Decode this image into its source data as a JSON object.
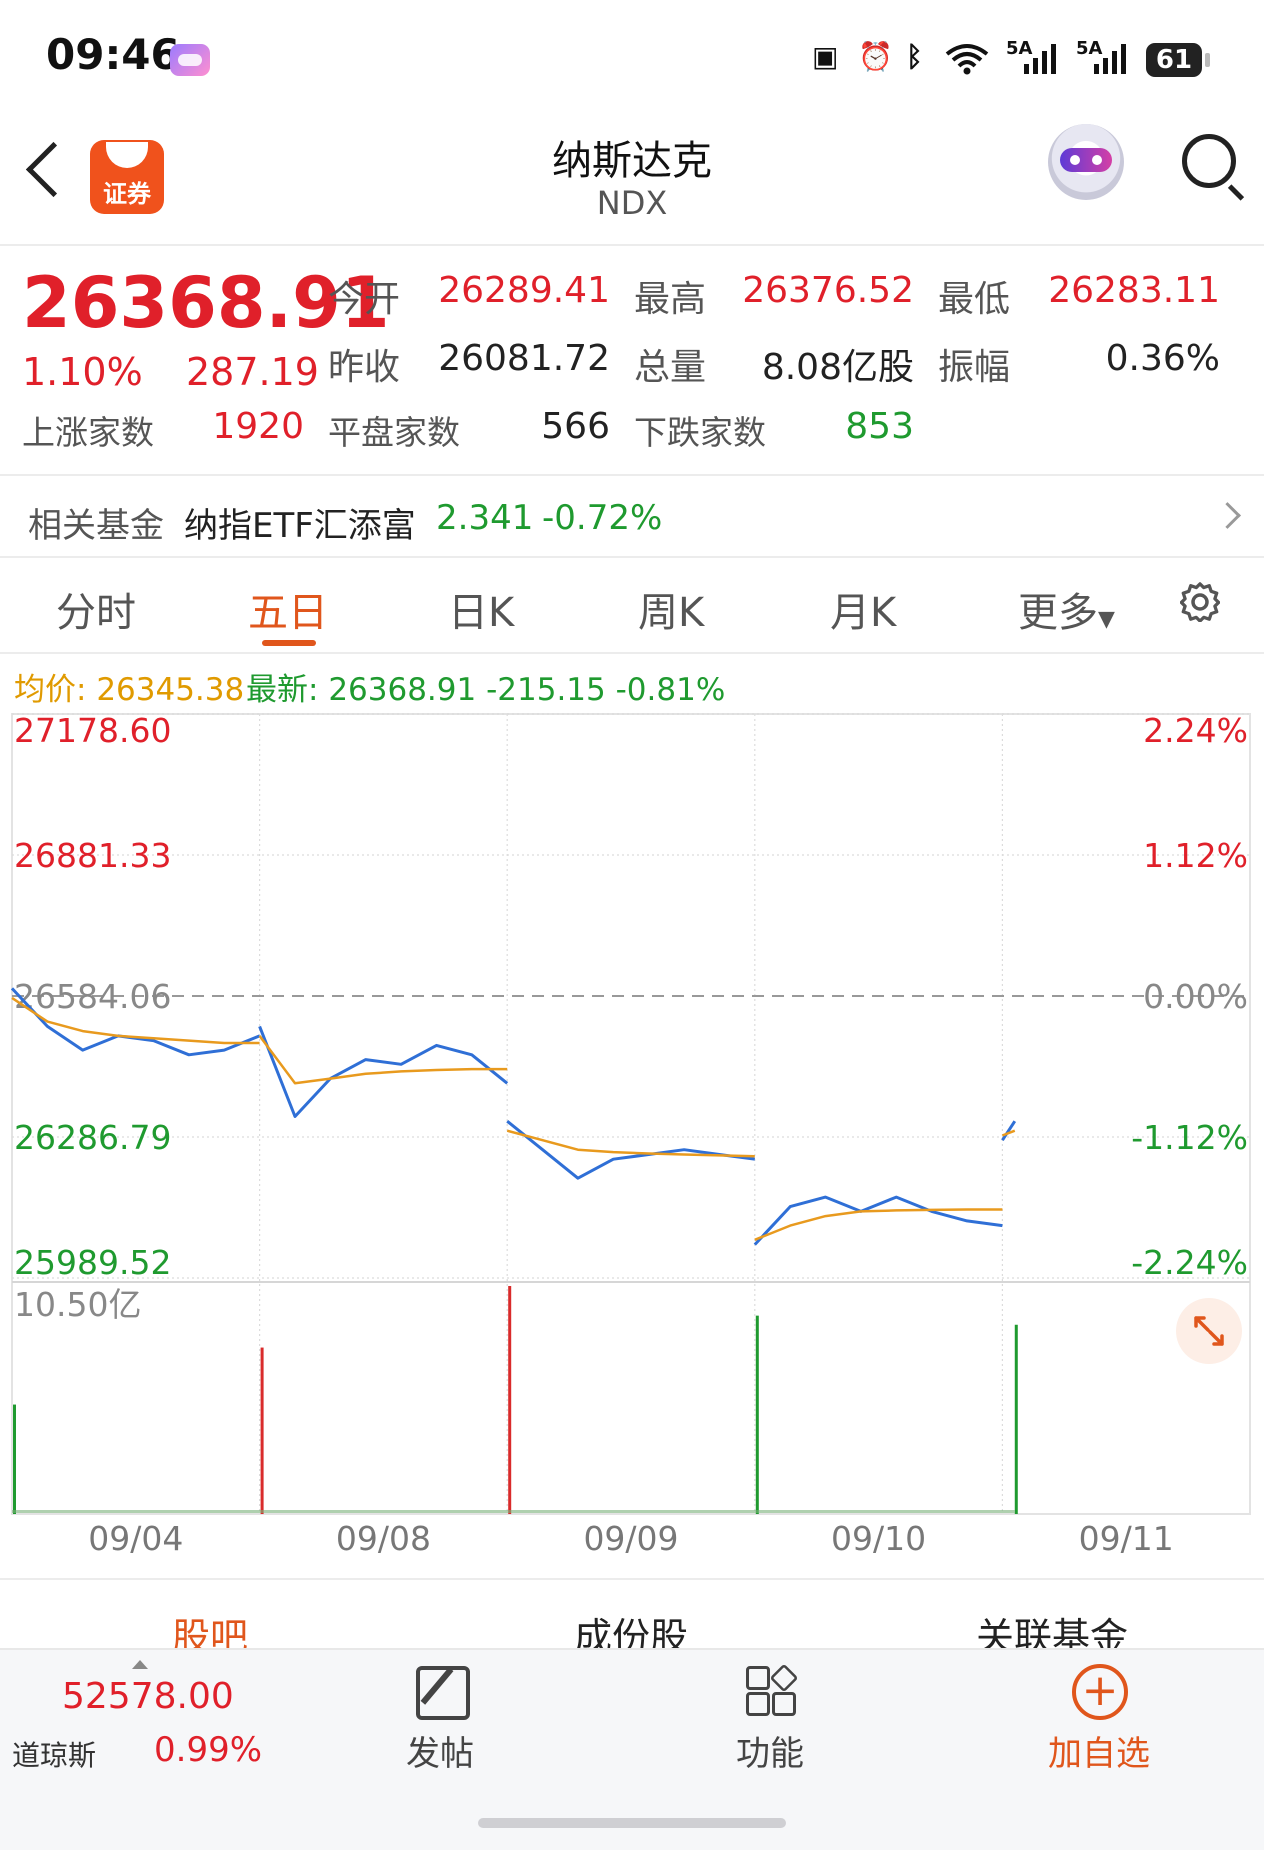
{
  "status_bar": {
    "time": "09:46",
    "network_1": "5A",
    "network_2": "5A",
    "battery": "61"
  },
  "header": {
    "title": "纳斯达克",
    "subtitle": "NDX",
    "broker_logo_text": "证券"
  },
  "quote": {
    "last": "26368.91",
    "pct": "1.10%",
    "change": "287.19",
    "open_label": "今开",
    "open": "26289.41",
    "high_label": "最高",
    "high": "26376.52",
    "low_label": "最低",
    "low": "26283.11",
    "prev_close_label": "昨收",
    "prev_close": "26081.72",
    "volume_label": "总量",
    "volume": "8.08亿股",
    "amplitude_label": "振幅",
    "amplitude": "0.36%",
    "up_label": "上涨家数",
    "up": "1920",
    "flat_label": "平盘家数",
    "flat": "566",
    "down_label": "下跌家数",
    "down": "853"
  },
  "fund": {
    "label": "相关基金",
    "name": "纳指ETF汇添富",
    "price": "2.341",
    "change": "-0.72%"
  },
  "tabs": [
    "分时",
    "五日",
    "日K",
    "周K",
    "月K",
    "更多"
  ],
  "active_tab": "五日",
  "chart_info": {
    "avg_label": "均价:",
    "avg": "26345.38",
    "latest_label": "最新:",
    "latest": "26368.91",
    "change": "-215.15",
    "pct": "-0.81%"
  },
  "chart_data": {
    "type": "line",
    "title": "",
    "x_labels": [
      "09/04",
      "09/08",
      "09/09",
      "09/10",
      "09/11"
    ],
    "y_ticks": [
      "27178.60",
      "26881.33",
      "26584.06",
      "26286.79",
      "25989.52"
    ],
    "y_pct_ticks": [
      "2.24%",
      "1.12%",
      "0.00%",
      "-1.12%",
      "-2.24%"
    ],
    "ylim": [
      25989.52,
      27178.6
    ],
    "base": 26584.06,
    "series": [
      {
        "name": "最新",
        "color": "#2f6fd6",
        "days": [
          [
            26600,
            26520,
            26470,
            26500,
            26490,
            26460,
            26470,
            26500
          ],
          [
            26520,
            26330,
            26410,
            26450,
            26440,
            26480,
            26460,
            26400
          ],
          [
            26320,
            26260,
            26200,
            26240,
            26250,
            26260,
            26250,
            26240
          ],
          [
            26060,
            26140,
            26160,
            26130,
            26160,
            26130,
            26110,
            26100
          ],
          [
            26280,
            26320
          ]
        ]
      },
      {
        "name": "均价",
        "color": "#e89a1e",
        "days": [
          [
            26580,
            26530,
            26510,
            26500,
            26495,
            26490,
            26485,
            26485
          ],
          [
            26500,
            26400,
            26410,
            26420,
            26425,
            26428,
            26430,
            26430
          ],
          [
            26300,
            26280,
            26260,
            26255,
            26252,
            26250,
            26248,
            26246
          ],
          [
            26070,
            26100,
            26120,
            26130,
            26132,
            26133,
            26134,
            26134
          ],
          [
            26290,
            26300
          ]
        ]
      }
    ],
    "volume": {
      "max_label": "10.50亿",
      "spikes": [
        {
          "day": 0,
          "pos": "start",
          "value": 0.48,
          "color": "#1f9a2f"
        },
        {
          "day": 1,
          "pos": "start",
          "value": 0.73,
          "color": "#d92b2b"
        },
        {
          "day": 2,
          "pos": "start",
          "value": 1.0,
          "color": "#d92b2b"
        },
        {
          "day": 3,
          "pos": "start",
          "value": 0.87,
          "color": "#1f9a2f"
        },
        {
          "day": 4,
          "pos": "end",
          "value": 0.83,
          "color": "#1f9a2f"
        }
      ]
    }
  },
  "bottom_tabs": [
    "股吧",
    "成份股",
    "关联基金"
  ],
  "bottom_nav": {
    "dow_value": "52578.00",
    "dow_name": "道琼斯",
    "dow_pct": "0.99%",
    "post": "发帖",
    "function": "功能",
    "add_watch": "加自选"
  },
  "colors": {
    "up": "#e0202a",
    "down": "#1f9a2f",
    "accent": "#e0561c",
    "avg": "#e09a00"
  }
}
